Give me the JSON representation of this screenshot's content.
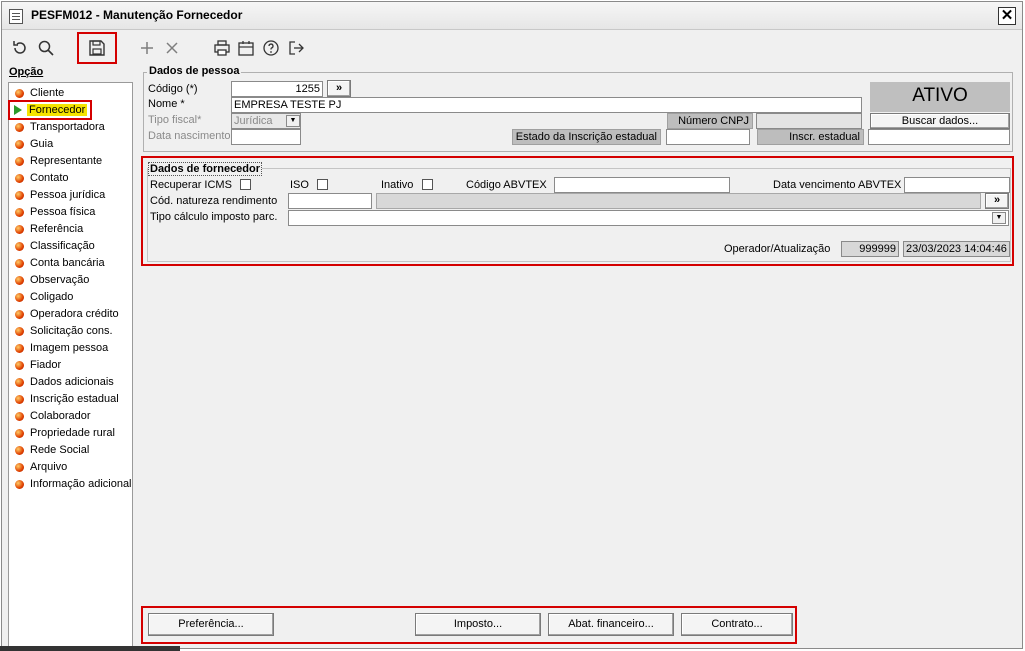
{
  "window": {
    "title": "PESFM012 - Manutenção Fornecedor",
    "close_label": "✕"
  },
  "toolbar": {
    "buttons": [
      {
        "name": "refresh-icon"
      },
      {
        "name": "search-icon"
      },
      {
        "name": "save-icon"
      },
      {
        "name": "add-icon"
      },
      {
        "name": "delete-icon"
      },
      {
        "name": "print-icon"
      },
      {
        "name": "calendar-icon"
      },
      {
        "name": "help-icon"
      },
      {
        "name": "exit-icon"
      }
    ]
  },
  "sidebar": {
    "header": "Opção",
    "items": [
      {
        "label": "Cliente"
      },
      {
        "label": "Fornecedor",
        "selected": true
      },
      {
        "label": "Transportadora"
      },
      {
        "label": "Guia"
      },
      {
        "label": "Representante"
      },
      {
        "label": "Contato"
      },
      {
        "label": "Pessoa jurídica"
      },
      {
        "label": "Pessoa física"
      },
      {
        "label": "Referência"
      },
      {
        "label": "Classificação"
      },
      {
        "label": "Conta bancária"
      },
      {
        "label": "Observação"
      },
      {
        "label": "Coligado"
      },
      {
        "label": "Operadora crédito"
      },
      {
        "label": "Solicitação cons."
      },
      {
        "label": "Imagem pessoa"
      },
      {
        "label": "Fiador"
      },
      {
        "label": "Dados adicionais"
      },
      {
        "label": "Inscrição estadual"
      },
      {
        "label": "Colaborador"
      },
      {
        "label": "Propriedade rural"
      },
      {
        "label": "Rede Social"
      },
      {
        "label": "Arquivo"
      },
      {
        "label": "Informação adicional"
      }
    ]
  },
  "pessoa": {
    "title": "Dados de pessoa",
    "codigo_label": "Código (*)",
    "codigo_value": "1255",
    "codigo_btn": "»",
    "nome_label": "Nome *",
    "nome_value": "EMPRESA TESTE PJ",
    "tipo_fiscal_label": "Tipo fiscal*",
    "tipo_fiscal_value": "Jurídica",
    "data_nasc_label": "Data nascimento",
    "cnpj_label": "Número CNPJ",
    "estado_ie_label": "Estado da Inscrição estadual",
    "inscr_label": "Inscr. estadual",
    "status": "ATIVO",
    "buscar_label": "Buscar dados..."
  },
  "fornecedor": {
    "title": "Dados de fornecedor",
    "recuperar_icms_label": "Recuperar ICMS",
    "iso_label": "ISO",
    "inativo_label": "Inativo",
    "codigo_abvtex_label": "Código ABVTEX",
    "data_venc_label": "Data vencimento ABVTEX",
    "cod_natureza_label": "Cód. natureza rendimento",
    "cod_natureza_btn": "»",
    "tipo_calculo_label": "Tipo cálculo imposto parc.",
    "operador_label": "Operador/Atualização",
    "operador_value": "999999",
    "atualizacao_value": "23/03/2023 14:04:46"
  },
  "bottom_buttons": {
    "preferencia": "Preferência...",
    "imposto": "Imposto...",
    "abat": "Abat. financeiro...",
    "contrato": "Contrato..."
  }
}
